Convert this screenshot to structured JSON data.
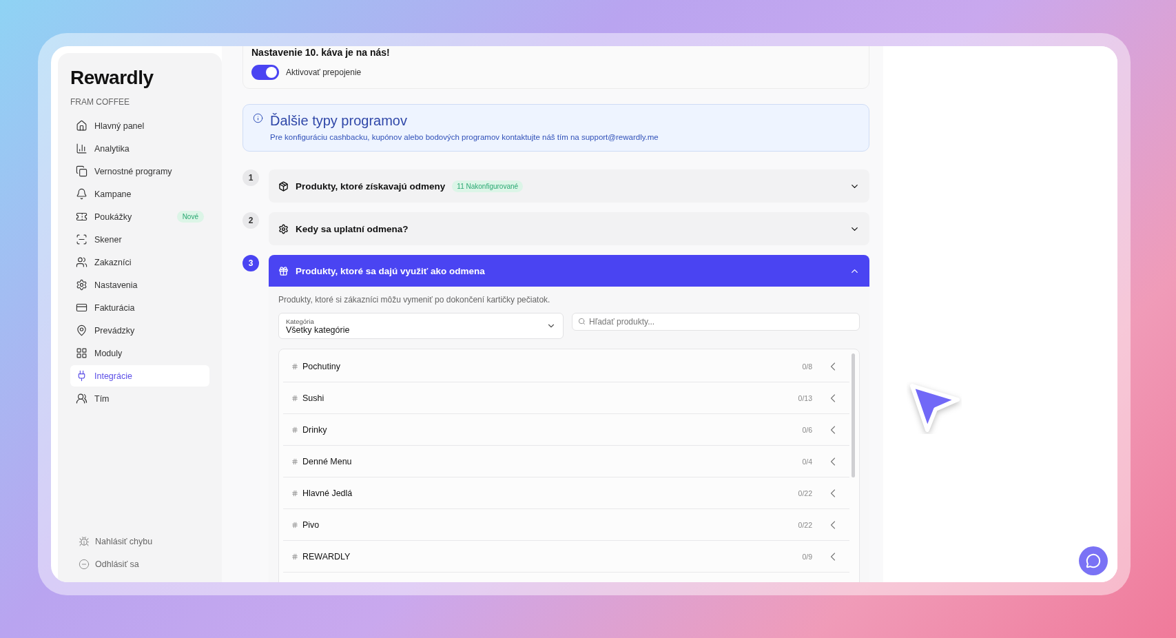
{
  "brand": {
    "logo": "Rewardly",
    "company": "FRAM COFFEE"
  },
  "sidebar": {
    "items": [
      {
        "label": "Hlavný panel",
        "selected": false
      },
      {
        "label": "Analytika",
        "selected": false
      },
      {
        "label": "Vernostné programy",
        "selected": false
      },
      {
        "label": "Kampane",
        "selected": false
      },
      {
        "label": "Poukážky",
        "selected": false,
        "badge": "Nové"
      },
      {
        "label": "Skener",
        "selected": false
      },
      {
        "label": "Zakazníci",
        "selected": false
      },
      {
        "label": "Nastavenia",
        "selected": false
      },
      {
        "label": "Fakturácia",
        "selected": false
      },
      {
        "label": "Prevádzky",
        "selected": false
      },
      {
        "label": "Moduly",
        "selected": false
      },
      {
        "label": "Integrácie",
        "selected": true
      },
      {
        "label": "Tím",
        "selected": false
      }
    ],
    "footer": [
      {
        "label": "Nahlásiť chybu"
      },
      {
        "label": "Odhlásiť sa"
      }
    ]
  },
  "integration": {
    "title": "Nastavenie 10. káva je na nás!",
    "toggle": {
      "label": "Aktivovať prepojenie",
      "on": true
    }
  },
  "info": {
    "title": "Ďalšie typy programov",
    "text": "Pre konfiguráciu cashbacku, kupónov alebo bodových programov kontaktujte náš tím na support@rewardly.me"
  },
  "steps": [
    {
      "number": "1",
      "title": "Produkty, ktoré získavajú odmeny",
      "badge": "11 Nakonfigurované",
      "expanded": false
    },
    {
      "number": "2",
      "title": "Kedy sa uplatní odmena?",
      "expanded": false
    },
    {
      "number": "3",
      "title": "Produkty, ktoré sa dajú využiť ako odmena",
      "expanded": true
    }
  ],
  "rewards": {
    "description": "Produkty, ktoré si zákazníci môžu vymeniť po dokončení kartičky pečiatok.",
    "category": {
      "label": "Kategória",
      "value": "Všetky kategórie"
    },
    "search": {
      "placeholder": "Hľadať produkty..."
    },
    "categories": [
      {
        "name": "Pochutiny",
        "count": "0/8"
      },
      {
        "name": "Sushi",
        "count": "0/13"
      },
      {
        "name": "Drinky",
        "count": "0/6"
      },
      {
        "name": "Denné Menu",
        "count": "0/4"
      },
      {
        "name": "Hlavné Jedlá",
        "count": "0/22"
      },
      {
        "name": "Pivo",
        "count": "0/22"
      },
      {
        "name": "REWARDLY",
        "count": "0/9"
      }
    ]
  }
}
